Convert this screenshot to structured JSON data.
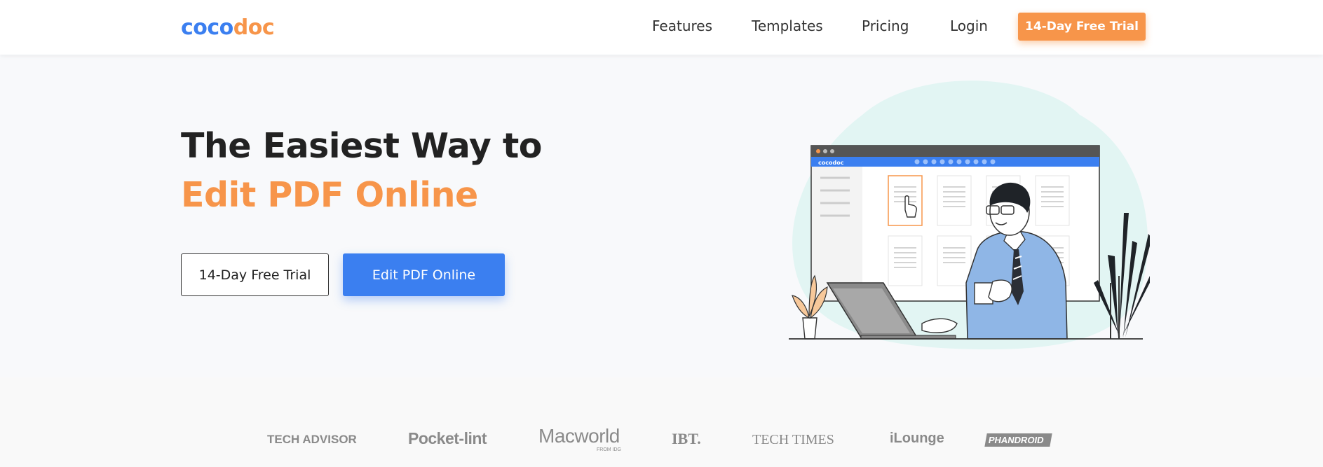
{
  "header": {
    "logo": {
      "part1": "coco",
      "part2": "doc"
    },
    "nav": [
      "Features",
      "Templates",
      "Pricing",
      "Login"
    ],
    "cta": "14-Day Free Trial"
  },
  "hero": {
    "title_line1": "The Easiest Way to",
    "title_line2": "Edit PDF Online",
    "btn_trial": "14-Day Free Trial",
    "btn_edit": "Edit PDF Online",
    "illustration": {
      "app_name": "cocodoc"
    }
  },
  "press": [
    "TECH ADVISOR",
    "Pocket-lint",
    "Macworld",
    "FROM IDG",
    "IBT.",
    "TECH TIMES",
    "iLounge",
    "PHANDROID"
  ],
  "colors": {
    "brand_blue": "#3b7ff0",
    "brand_orange": "#f7954a",
    "hero_bg": "#f8f9fb",
    "text": "#222222"
  }
}
